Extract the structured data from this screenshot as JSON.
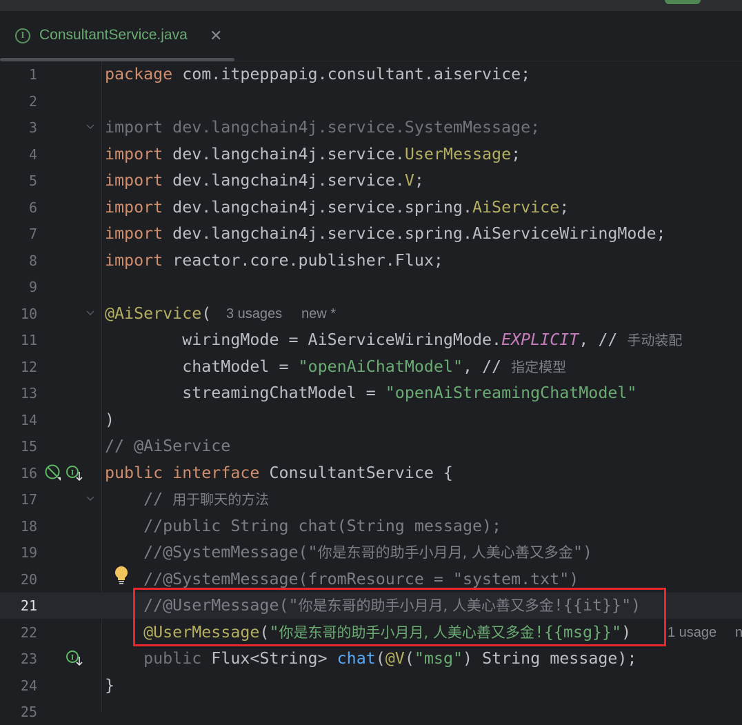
{
  "tab": {
    "label": "ConsultantService.java",
    "icon": "interface-icon",
    "close_icon": "close-icon",
    "close_glyph": "✕",
    "icon_glyph": "I"
  },
  "hint_line10": {
    "usages": "3 usages",
    "author": "new *"
  },
  "hint_line22": {
    "usages": "1 usage",
    "author": "n"
  },
  "lines": [
    {
      "no": "1",
      "parts": [
        "package",
        " com.itpeppapig.consultant.aiservice;"
      ]
    },
    {
      "no": "2",
      "parts": []
    },
    {
      "no": "3",
      "parts": [
        "import dev.langchain4j.service.SystemMessage;"
      ]
    },
    {
      "no": "4",
      "parts": [
        "import",
        " dev.langchain4j.service.",
        "UserMessage",
        ";"
      ]
    },
    {
      "no": "5",
      "parts": [
        "import",
        " dev.langchain4j.service.",
        "V",
        ";"
      ]
    },
    {
      "no": "6",
      "parts": [
        "import",
        " dev.langchain4j.service.spring.",
        "AiService",
        ";"
      ]
    },
    {
      "no": "7",
      "parts": [
        "import",
        " dev.langchain4j.service.spring.AiServiceWiringMode;"
      ]
    },
    {
      "no": "8",
      "parts": [
        "import",
        " reactor.core.publisher.Flux;"
      ]
    },
    {
      "no": "9",
      "parts": []
    },
    {
      "no": "10",
      "parts": [
        "@AiService",
        "("
      ]
    },
    {
      "no": "11",
      "parts": [
        "        wiringMode = AiServiceWiringMode.",
        "EXPLICIT",
        ", // ",
        "手动装配"
      ]
    },
    {
      "no": "12",
      "parts": [
        "        chatModel = ",
        "\"openAiChatModel\"",
        ", // ",
        "指定模型"
      ]
    },
    {
      "no": "13",
      "parts": [
        "        streamingChatModel = ",
        "\"openAiStreamingChatModel\""
      ]
    },
    {
      "no": "14",
      "parts": [
        ")"
      ]
    },
    {
      "no": "15",
      "parts": [
        "// @AiService"
      ]
    },
    {
      "no": "16",
      "parts": [
        "public",
        " ",
        "interface",
        " ConsultantService {"
      ]
    },
    {
      "no": "17",
      "parts": [
        "    // ",
        "用于聊天的方法"
      ]
    },
    {
      "no": "18",
      "parts": [
        "    //public String chat(String message);"
      ]
    },
    {
      "no": "19",
      "parts": [
        "    //@SystemMessage(\"",
        "你是东哥的助手小月月, 人美心善又多金",
        "\")"
      ]
    },
    {
      "no": "20",
      "parts": [
        "    //@SystemMessage(fromResource = \"system.txt\")"
      ]
    },
    {
      "no": "21",
      "parts": [
        "    //@UserMessage(\"",
        "你是东哥的助手小月月, 人美心善又多金",
        "!{{it}}\")"
      ]
    },
    {
      "no": "22",
      "parts": [
        "    ",
        "@UserMessage",
        "(",
        "\"",
        "你是东哥的助手小月月, 人美心善又多金",
        "!{{msg}}\"",
        ")"
      ]
    },
    {
      "no": "23",
      "parts": [
        "    public",
        " Flux<String> ",
        "chat",
        "(",
        "@V",
        "(",
        "\"msg\"",
        ") String message);"
      ]
    },
    {
      "no": "24",
      "parts": [
        "}"
      ]
    },
    {
      "no": "25",
      "parts": []
    }
  ],
  "gutter_icons": {
    "line16": [
      "no-bean-icon",
      "implemented-interface-icon"
    ],
    "line20": "lightbulb-icon",
    "line23": "implemented-method-icon"
  },
  "colors": {
    "background": "#1e1f22",
    "keyword": "#cf8e6d",
    "string": "#6aab73",
    "annotation": "#b3ae60",
    "comment": "#7a7e85",
    "highlight_box": "#e8262b",
    "current_line": "#26282e"
  }
}
